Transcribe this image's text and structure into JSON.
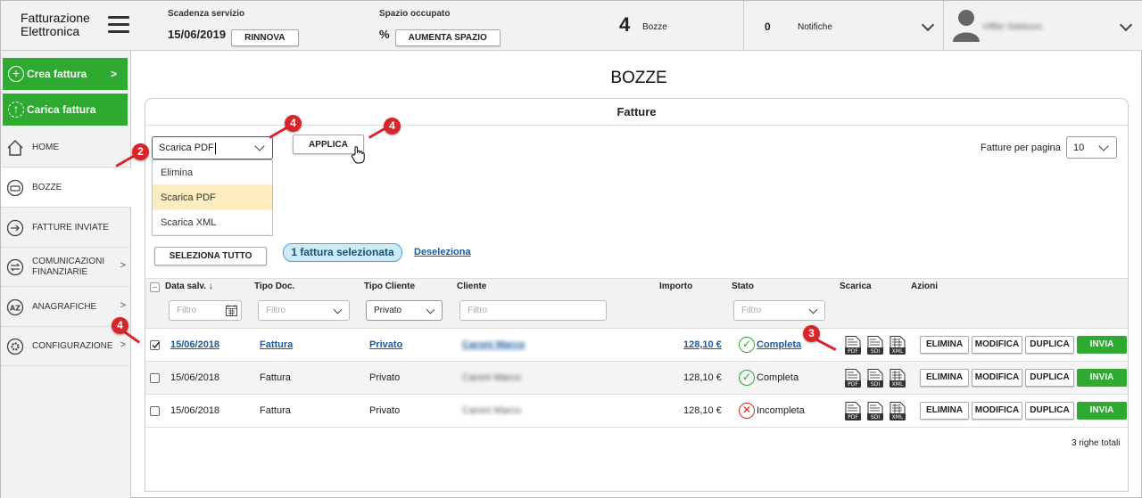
{
  "header": {
    "logo_line1": "Fatturazione",
    "logo_line2": "Elettronica",
    "scadenza_label": "Scadenza servizio",
    "scadenza_date": "15/06/2019",
    "rinnova_label": "RINNOVA",
    "spazio_label": "Spazio occupato",
    "spazio_value": "%",
    "aumenta_label": "AUMENTA SPAZIO",
    "bozze_count": "4",
    "bozze_label": "Bozze",
    "notifiche_count": "0",
    "notifiche_label": "Notifiche",
    "username": "Viffite Siddsoro"
  },
  "sidebar": {
    "crea": "Crea fattura",
    "carica": "Carica fattura",
    "items": [
      {
        "label": "HOME"
      },
      {
        "label": "BOZZE"
      },
      {
        "label": "FATTURE INVIATE"
      },
      {
        "label_line1": "COMUNICAZIONI",
        "label_line2": "FINANZIARIE"
      },
      {
        "label": "ANAGRAFICHE"
      },
      {
        "label": "CONFIGURAZIONE"
      }
    ]
  },
  "main": {
    "page_title": "BOZZE",
    "panel_title": "Fatture",
    "action_select": "Scarica PDF",
    "applica": "APPLICA",
    "dropdown": [
      "Elimina",
      "Scarica PDF",
      "Scarica XML"
    ],
    "per_page_label": "Fatture per pagina",
    "per_page_value": "10",
    "seleziona_tutto": "SELEZIONA TUTTO",
    "selected_pill": "1 fattura selezionata",
    "deseleziona": "Deseleziona",
    "total_rows": "3 righe totali"
  },
  "table": {
    "columns": [
      "Data salv.",
      "Tipo Doc.",
      "Tipo Cliente",
      "Cliente",
      "Importo",
      "Stato",
      "Scarica",
      "Azioni"
    ],
    "filter_placeholder": "Filtro",
    "tipo_cliente_filter": "Privato",
    "rows": [
      {
        "date": "15/06/2018",
        "tipo_doc": "Fattura",
        "tipo_cliente": "Privato",
        "cliente": "Caroni Marco",
        "importo": "128,10 €",
        "stato": "Completa"
      },
      {
        "date": "15/06/2018",
        "tipo_doc": "Fattura",
        "tipo_cliente": "Privato",
        "cliente": "Caroni Marco",
        "importo": "128,10 €",
        "stato": "Completa"
      },
      {
        "date": "15/06/2018",
        "tipo_doc": "Fattura",
        "tipo_cliente": "Privato",
        "cliente": "Caroni Marco",
        "importo": "128,10 €",
        "stato": "Incompleta"
      }
    ],
    "actions": {
      "elimina": "ELIMINA",
      "modifica": "MODIFICA",
      "duplica": "DUPLICA",
      "invia": "INVIA"
    },
    "file_labels": {
      "pdf": "PDF",
      "sdi": "SDI",
      "xml": "XML"
    }
  },
  "annotations": [
    "4",
    "4",
    "2",
    "4",
    "3"
  ],
  "colors": {
    "green": "#2eaa31",
    "marker_red": "#d9252a",
    "pill_blue": "#cdeaf7",
    "highlight": "#fdecc0"
  }
}
